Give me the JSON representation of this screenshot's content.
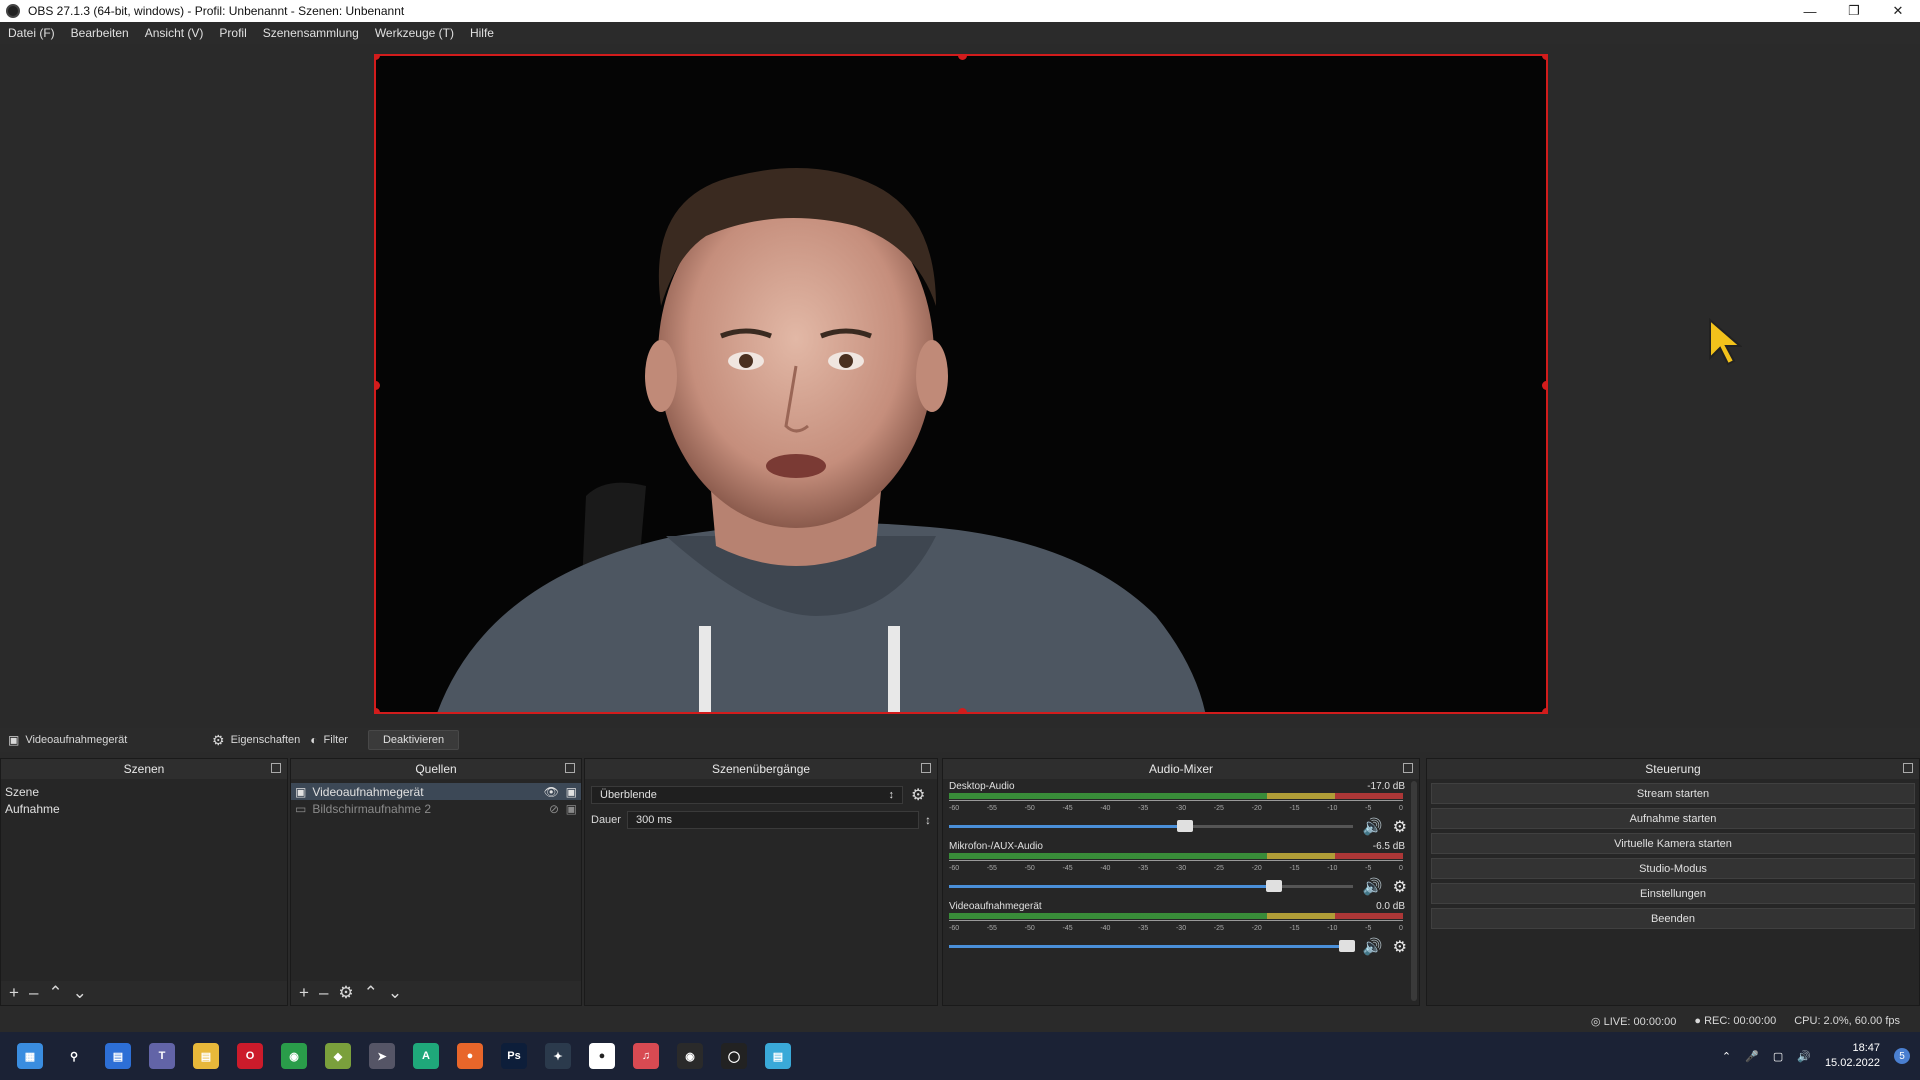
{
  "window": {
    "title": "OBS 27.1.3 (64-bit, windows) - Profil: Unbenannt - Szenen: Unbenannt"
  },
  "menu": [
    "Datei (F)",
    "Bearbeiten",
    "Ansicht (V)",
    "Profil",
    "Szenensammlung",
    "Werkzeuge (T)",
    "Hilfe"
  ],
  "sourcebar": {
    "source_name": "Videoaufnahmegerät",
    "properties": "Eigenschaften",
    "filter": "Filter",
    "deactivate": "Deaktivieren"
  },
  "scenes": {
    "title": "Szenen",
    "items": [
      "Szene",
      "Aufnahme"
    ]
  },
  "sources": {
    "title": "Quellen",
    "items": [
      "Videoaufnahmegerät",
      "Bildschirmaufnahme 2"
    ]
  },
  "transitions": {
    "title": "Szenenübergänge",
    "selected": "Überblende",
    "duration_label": "Dauer",
    "duration_value": "300 ms"
  },
  "mixer": {
    "title": "Audio-Mixer",
    "tick_labels": [
      "-60",
      "-55",
      "-50",
      "-45",
      "-40",
      "-35",
      "-30",
      "-25",
      "-20",
      "-15",
      "-10",
      "-5",
      "0"
    ],
    "channels": [
      {
        "name": "Desktop-Audio",
        "db": "-17.0 dB",
        "volume": 0.6
      },
      {
        "name": "Mikrofon-/AUX-Audio",
        "db": "-6.5 dB",
        "volume": 0.82
      },
      {
        "name": "Videoaufnahmegerät",
        "db": "0.0 dB",
        "volume": 1.0
      }
    ]
  },
  "controls": {
    "title": "Steuerung",
    "buttons": [
      "Stream starten",
      "Aufnahme starten",
      "Virtuelle Kamera starten",
      "Studio-Modus",
      "Einstellungen",
      "Beenden"
    ]
  },
  "status": {
    "live": "LIVE: 00:00:00",
    "rec": "REC: 00:00:00",
    "cpu": "CPU: 2.0%, 60.00 fps"
  },
  "taskbar": {
    "time": "18:47",
    "date": "15.02.2022",
    "notification_count": "5",
    "apps": [
      "windows-start",
      "search",
      "widgets",
      "teams",
      "file-explorer",
      "opera",
      "chrome",
      "sublime",
      "launcher",
      "android-studio",
      "firefox",
      "photoshop",
      "davinci",
      "cricut",
      "music",
      "obs",
      "spotify",
      "notepad"
    ]
  },
  "colors": {
    "accent": "#d21c1c",
    "selection": "#3c4856",
    "taskbar": "#1b2235"
  }
}
